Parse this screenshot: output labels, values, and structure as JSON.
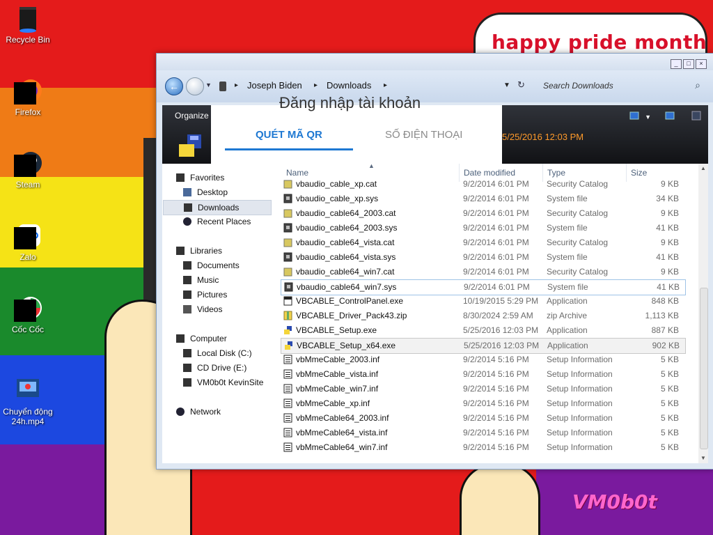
{
  "desktop": {
    "stripe_colors": [
      "#e41b1b",
      "#ef7b16",
      "#f5e316",
      "#1a8a2c",
      "#1c48e0",
      "#7a1a9e"
    ],
    "bubble_text": "happy pride month",
    "signature": "VM0b0t",
    "icons": [
      {
        "label": "Recycle Bin",
        "icon": "recycle-bin-icon"
      },
      {
        "label": "Firefox",
        "icon": "firefox-icon"
      },
      {
        "label": "Steam",
        "icon": "steam-icon"
      },
      {
        "label": "Zalo",
        "icon": "zalo-icon"
      },
      {
        "label": "Cốc Cốc",
        "icon": "coccoc-icon"
      },
      {
        "label": "Chuyển động 24h.mp4",
        "icon": "video-file-icon"
      }
    ]
  },
  "explorer": {
    "breadcrumb": [
      "Joseph Biden",
      "Downloads"
    ],
    "search_placeholder": "Search Downloads",
    "toolbar": {
      "organize": "Organize",
      "selected_date": "5/25/2016 12:03 PM"
    },
    "overlay": {
      "title": "Đăng nhập tài khoản",
      "tab_qr": "QUÉT MÃ QR",
      "tab_phone": "SỐ ĐIỆN THOẠI",
      "accent": "#1e78d2"
    },
    "nav": {
      "favorites": "Favorites",
      "desktop": "Desktop",
      "downloads": "Downloads",
      "recent": "Recent Places",
      "libraries": "Libraries",
      "documents": "Documents",
      "music": "Music",
      "pictures": "Pictures",
      "videos": "Videos",
      "computer": "Computer",
      "local_disk": "Local Disk (C:)",
      "cd_drive": "CD Drive (E:)",
      "vm": "VM0b0t KevinSite",
      "network": "Network"
    },
    "columns": {
      "name": "Name",
      "date": "Date modified",
      "type": "Type",
      "size": "Size"
    },
    "files": [
      {
        "name": "vbaudio_cable_xp.cat",
        "date": "9/2/2014 6:01 PM",
        "type": "Security Catalog",
        "size": "9 KB",
        "icon": "catalog-icon"
      },
      {
        "name": "vbaudio_cable_xp.sys",
        "date": "9/2/2014 6:01 PM",
        "type": "System file",
        "size": "34 KB",
        "icon": "system-file-icon"
      },
      {
        "name": "vbaudio_cable64_2003.cat",
        "date": "9/2/2014 6:01 PM",
        "type": "Security Catalog",
        "size": "9 KB",
        "icon": "catalog-icon"
      },
      {
        "name": "vbaudio_cable64_2003.sys",
        "date": "9/2/2014 6:01 PM",
        "type": "System file",
        "size": "41 KB",
        "icon": "system-file-icon"
      },
      {
        "name": "vbaudio_cable64_vista.cat",
        "date": "9/2/2014 6:01 PM",
        "type": "Security Catalog",
        "size": "9 KB",
        "icon": "catalog-icon"
      },
      {
        "name": "vbaudio_cable64_vista.sys",
        "date": "9/2/2014 6:01 PM",
        "type": "System file",
        "size": "41 KB",
        "icon": "system-file-icon"
      },
      {
        "name": "vbaudio_cable64_win7.cat",
        "date": "9/2/2014 6:01 PM",
        "type": "Security Catalog",
        "size": "9 KB",
        "icon": "catalog-icon"
      },
      {
        "name": "vbaudio_cable64_win7.sys",
        "date": "9/2/2014 6:01 PM",
        "type": "System file",
        "size": "41 KB",
        "icon": "system-file-icon"
      },
      {
        "name": "VBCABLE_ControlPanel.exe",
        "date": "10/19/2015 5:29 PM",
        "type": "Application",
        "size": "848 KB",
        "icon": "application-icon"
      },
      {
        "name": "VBCABLE_Driver_Pack43.zip",
        "date": "8/30/2024 2:59 AM",
        "type": "zip Archive",
        "size": "1,113 KB",
        "icon": "zip-icon"
      },
      {
        "name": "VBCABLE_Setup.exe",
        "date": "5/25/2016 12:03 PM",
        "type": "Application",
        "size": "887 KB",
        "icon": "setup-icon"
      },
      {
        "name": "VBCABLE_Setup_x64.exe",
        "date": "5/25/2016 12:03 PM",
        "type": "Application",
        "size": "902 KB",
        "icon": "setup-icon"
      },
      {
        "name": "vbMmeCable_2003.inf",
        "date": "9/2/2014 5:16 PM",
        "type": "Setup Information",
        "size": "5 KB",
        "icon": "inf-icon"
      },
      {
        "name": "vbMmeCable_vista.inf",
        "date": "9/2/2014 5:16 PM",
        "type": "Setup Information",
        "size": "5 KB",
        "icon": "inf-icon"
      },
      {
        "name": "vbMmeCable_win7.inf",
        "date": "9/2/2014 5:16 PM",
        "type": "Setup Information",
        "size": "5 KB",
        "icon": "inf-icon"
      },
      {
        "name": "vbMmeCable_xp.inf",
        "date": "9/2/2014 5:16 PM",
        "type": "Setup Information",
        "size": "5 KB",
        "icon": "inf-icon"
      },
      {
        "name": "vbMmeCable64_2003.inf",
        "date": "9/2/2014 5:16 PM",
        "type": "Setup Information",
        "size": "5 KB",
        "icon": "inf-icon"
      },
      {
        "name": "vbMmeCable64_vista.inf",
        "date": "9/2/2014 5:16 PM",
        "type": "Setup Information",
        "size": "5 KB",
        "icon": "inf-icon"
      },
      {
        "name": "vbMmeCable64_win7.inf",
        "date": "9/2/2014 5:16 PM",
        "type": "Setup Information",
        "size": "5 KB",
        "icon": "inf-icon"
      }
    ]
  }
}
